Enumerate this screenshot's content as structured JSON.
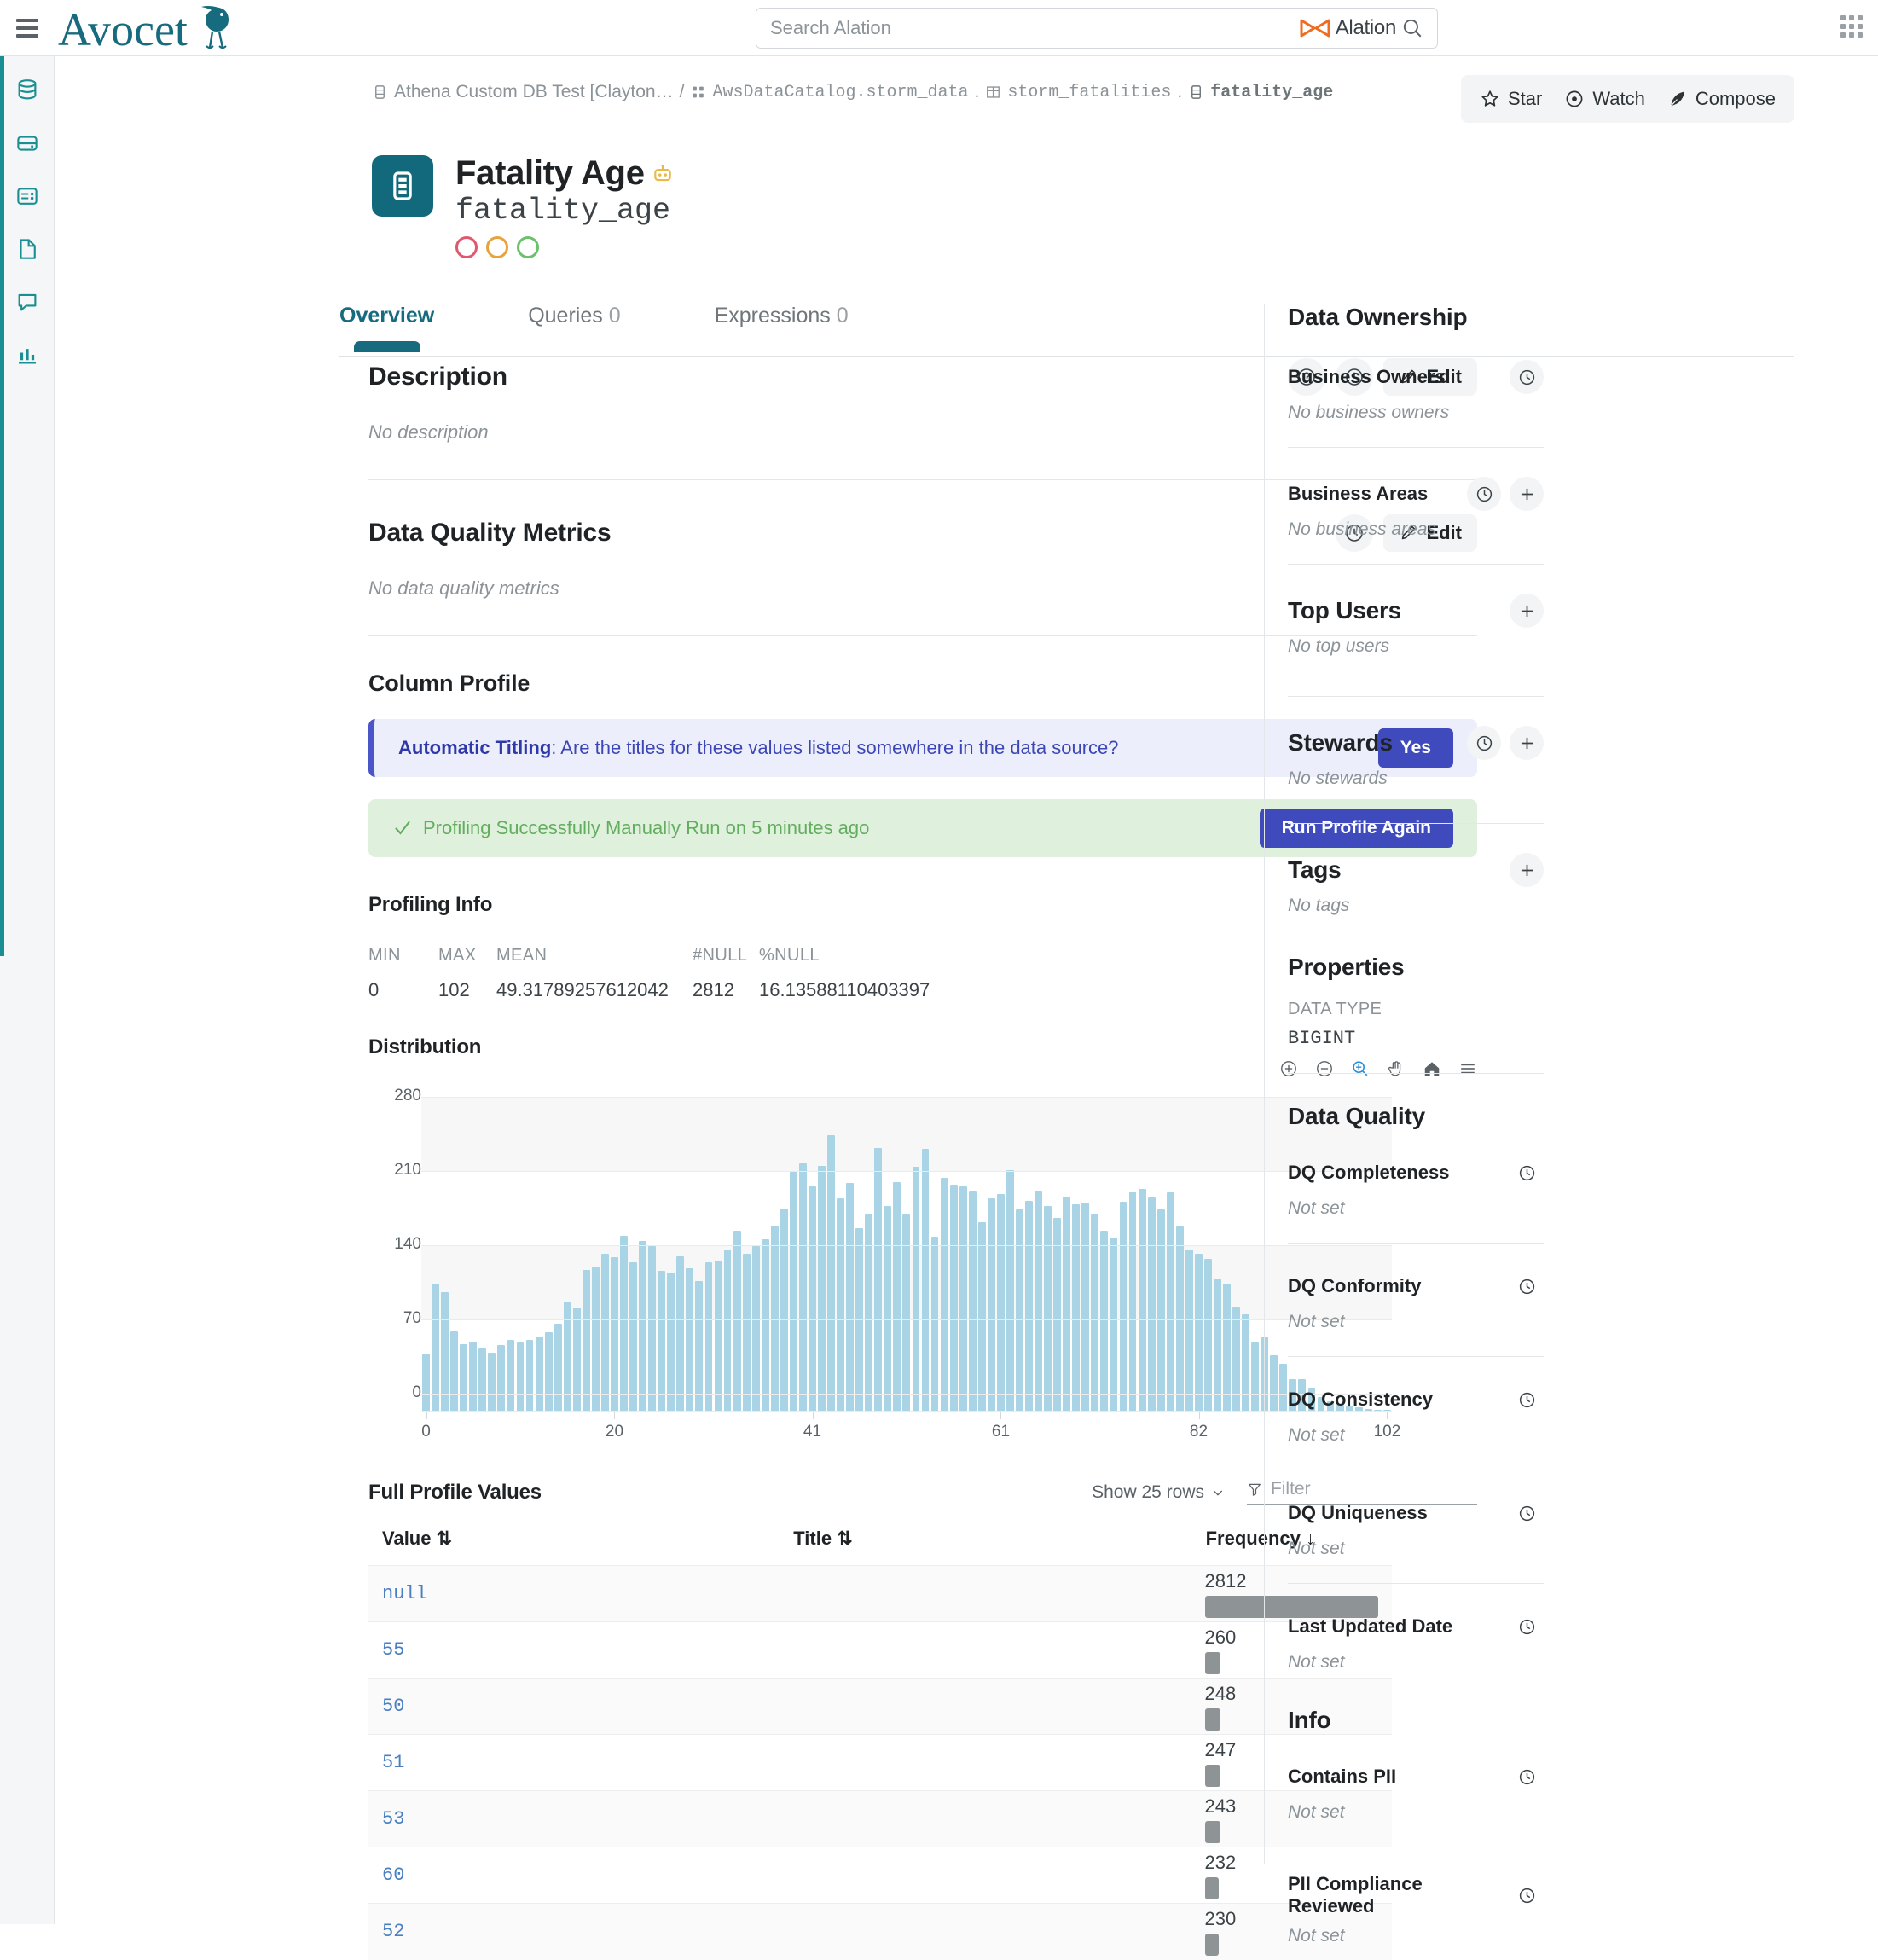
{
  "topbar": {
    "brand": "Avocet",
    "search_placeholder": "Search Alation",
    "search_value": "",
    "search_brand": "Alation"
  },
  "leftrail": {
    "items": [
      {
        "icon": "database-icon"
      },
      {
        "icon": "server-icon"
      },
      {
        "icon": "form-list-icon"
      },
      {
        "icon": "document-icon"
      },
      {
        "icon": "chat-icon"
      },
      {
        "icon": "bar-chart-icon"
      }
    ]
  },
  "breadcrumb": {
    "source": "Athena Custom DB Test [Clayton…",
    "sep1": "/",
    "catalog": "AwsDataCatalog.storm_data",
    "dot1": ".",
    "table": "storm_fatalities",
    "dot2": ".",
    "column": "fatality_age"
  },
  "actions": {
    "star": "Star",
    "watch": "Watch",
    "compose": "Compose"
  },
  "title": {
    "heading": "Fatality Age",
    "badge_icon": "robot-icon",
    "subtitle": "fatality_age",
    "dot_colors": [
      "#e2566e",
      "#e8a33d",
      "#6cc26c"
    ]
  },
  "tabs": [
    {
      "label": "Overview",
      "count": "",
      "active": true
    },
    {
      "label": "Queries",
      "count": "0",
      "active": false
    },
    {
      "label": "Expressions",
      "count": "0",
      "active": false
    }
  ],
  "description": {
    "title": "Description",
    "empty": "No description",
    "edit_label": "Edit"
  },
  "dq_metrics": {
    "title": "Data Quality Metrics",
    "empty": "No data quality metrics",
    "edit_label": "Edit"
  },
  "column_profile": {
    "title": "Column Profile",
    "auto_titling_label": "Automatic Titling",
    "auto_titling_question": ": Are the titles for these values listed somewhere in the data source?",
    "yes_label": "Yes",
    "success_message": "Profiling Successfully Manually Run on 5 minutes ago",
    "run_again_label": "Run Profile Again"
  },
  "profiling_info": {
    "title": "Profiling Info",
    "stats": [
      {
        "key": "MIN",
        "value": "0"
      },
      {
        "key": "MAX",
        "value": "102"
      },
      {
        "key": "MEAN",
        "value": "49.31789257612042"
      },
      {
        "key": "#NULL",
        "value": "2812"
      },
      {
        "key": "%NULL",
        "value": "16.13588110403397"
      }
    ]
  },
  "distribution": {
    "title": "Distribution",
    "toolbar": [
      "zoom-in-icon",
      "zoom-out-icon",
      "magnifier-icon",
      "pan-hand-icon",
      "home-icon",
      "menu-icon"
    ]
  },
  "chart_data": {
    "type": "bar",
    "title": "Distribution",
    "xlabel": "",
    "ylabel": "",
    "ylim": [
      0,
      280
    ],
    "yticks": [
      0,
      70,
      140,
      210,
      280
    ],
    "xticks": [
      0,
      20,
      41,
      61,
      82,
      102
    ],
    "grid": true,
    "legend": false,
    "categories": [
      0,
      1,
      2,
      3,
      4,
      5,
      6,
      7,
      8,
      9,
      10,
      11,
      12,
      13,
      14,
      15,
      16,
      17,
      18,
      19,
      20,
      21,
      22,
      23,
      24,
      25,
      26,
      27,
      28,
      29,
      30,
      31,
      32,
      33,
      34,
      35,
      36,
      37,
      38,
      39,
      40,
      41,
      42,
      43,
      44,
      45,
      46,
      47,
      48,
      49,
      50,
      51,
      52,
      53,
      54,
      55,
      56,
      57,
      58,
      59,
      60,
      61,
      62,
      63,
      64,
      65,
      66,
      67,
      68,
      69,
      70,
      71,
      72,
      73,
      74,
      75,
      76,
      77,
      78,
      79,
      80,
      81,
      82,
      83,
      84,
      85,
      86,
      87,
      88,
      89,
      90,
      91,
      92,
      93,
      94,
      95,
      96,
      97,
      98,
      99,
      100,
      101,
      102
    ],
    "values": [
      54,
      120,
      112,
      75,
      63,
      65,
      59,
      55,
      62,
      67,
      64,
      67,
      70,
      74,
      82,
      103,
      97,
      133,
      136,
      148,
      145,
      165,
      140,
      160,
      155,
      132,
      130,
      146,
      134,
      122,
      140,
      142,
      152,
      170,
      148,
      155,
      162,
      175,
      191,
      226,
      233,
      212,
      231,
      260,
      200,
      215,
      172,
      186,
      248,
      193,
      216,
      186,
      230,
      247,
      164,
      220,
      213,
      212,
      208,
      178,
      200,
      204,
      227,
      190,
      198,
      208,
      193,
      182,
      202,
      195,
      196,
      186,
      170,
      163,
      197,
      207,
      209,
      201,
      190,
      206,
      174,
      152,
      148,
      143,
      125,
      120,
      98,
      91,
      64,
      70,
      52,
      44,
      30,
      30,
      22,
      13,
      9,
      6,
      5,
      3,
      2,
      1,
      1
    ]
  },
  "full_profile": {
    "title": "Full Profile Values",
    "show_rows": "Show 25 rows",
    "filter_placeholder": "Filter",
    "filter_value": "",
    "columns": [
      {
        "label": "Value",
        "sort": "⇅"
      },
      {
        "label": "Title",
        "sort": "⇅"
      },
      {
        "label": "Frequency",
        "sort": "↓"
      }
    ],
    "rows": [
      {
        "value": "null",
        "title": "",
        "frequency": "2812",
        "bar_pct": 100
      },
      {
        "value": "55",
        "title": "",
        "frequency": "260",
        "bar_pct": 9
      },
      {
        "value": "50",
        "title": "",
        "frequency": "248",
        "bar_pct": 9
      },
      {
        "value": "51",
        "title": "",
        "frequency": "247",
        "bar_pct": 9
      },
      {
        "value": "53",
        "title": "",
        "frequency": "243",
        "bar_pct": 9
      },
      {
        "value": "60",
        "title": "",
        "frequency": "232",
        "bar_pct": 8
      },
      {
        "value": "52",
        "title": "",
        "frequency": "230",
        "bar_pct": 8
      }
    ]
  },
  "sidebar": {
    "data_ownership": {
      "heading": "Data Ownership",
      "business_owners": {
        "label": "Business Owners",
        "value": "No business owners"
      },
      "business_areas": {
        "label": "Business Areas",
        "value": "No business areas"
      }
    },
    "top_users": {
      "heading": "Top Users",
      "value": "No top users"
    },
    "stewards": {
      "heading": "Stewards",
      "value": "No stewards"
    },
    "tags": {
      "heading": "Tags",
      "value": "No tags"
    },
    "properties": {
      "heading": "Properties",
      "data_type_key": "DATA TYPE",
      "data_type_value": "BIGINT"
    },
    "data_quality": {
      "heading": "Data Quality",
      "items": [
        {
          "label": "DQ Completeness",
          "value": "Not set"
        },
        {
          "label": "DQ Conformity",
          "value": "Not set"
        },
        {
          "label": "DQ Consistency",
          "value": "Not set"
        },
        {
          "label": "DQ Uniqueness",
          "value": "Not set"
        },
        {
          "label": "Last Updated Date",
          "value": "Not set"
        }
      ]
    },
    "info": {
      "heading": "Info",
      "items": [
        {
          "label": "Contains PII",
          "value": "Not set"
        },
        {
          "label": "PII Compliance Reviewed",
          "value": "Not set"
        }
      ]
    }
  }
}
